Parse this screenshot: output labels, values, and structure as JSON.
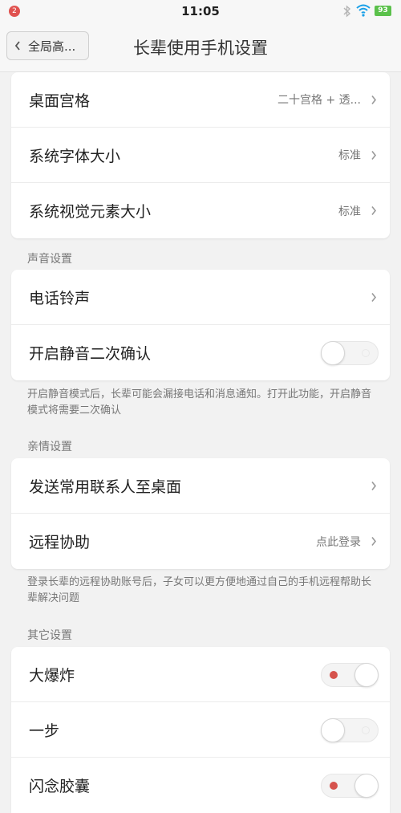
{
  "status_bar": {
    "notification_count": "2",
    "time": "11:05",
    "battery": "93"
  },
  "header": {
    "back_label": "全局高...",
    "title": "长辈使用手机设置"
  },
  "display_card": {
    "rows": [
      {
        "label": "桌面宫格",
        "value": "二十宫格 + 透..."
      },
      {
        "label": "系统字体大小",
        "value": "标准"
      },
      {
        "label": "系统视觉元素大小",
        "value": "标准"
      }
    ]
  },
  "sound_section": {
    "title": "声音设置",
    "rows": [
      {
        "label": "电话铃声"
      },
      {
        "label": "开启静音二次确认",
        "toggle": "off"
      }
    ],
    "note": "开启静音模式后，长辈可能会漏接电话和消息通知。打开此功能，开启静音模式将需要二次确认"
  },
  "family_section": {
    "title": "亲情设置",
    "rows": [
      {
        "label": "发送常用联系人至桌面"
      },
      {
        "label": "远程协助",
        "value": "点此登录"
      }
    ],
    "note": "登录长辈的远程协助账号后，子女可以更方便地通过自己的手机远程帮助长辈解决问题"
  },
  "other_section": {
    "title": "其它设置",
    "rows": [
      {
        "label": "大爆炸",
        "toggle": "on"
      },
      {
        "label": "一步",
        "toggle": "off"
      },
      {
        "label": "闪念胶囊",
        "toggle": "on"
      }
    ]
  },
  "colors": {
    "toggle_on_indicator": "#d6534d",
    "battery": "#5bc14b",
    "wifi": "#1aa0e8"
  }
}
